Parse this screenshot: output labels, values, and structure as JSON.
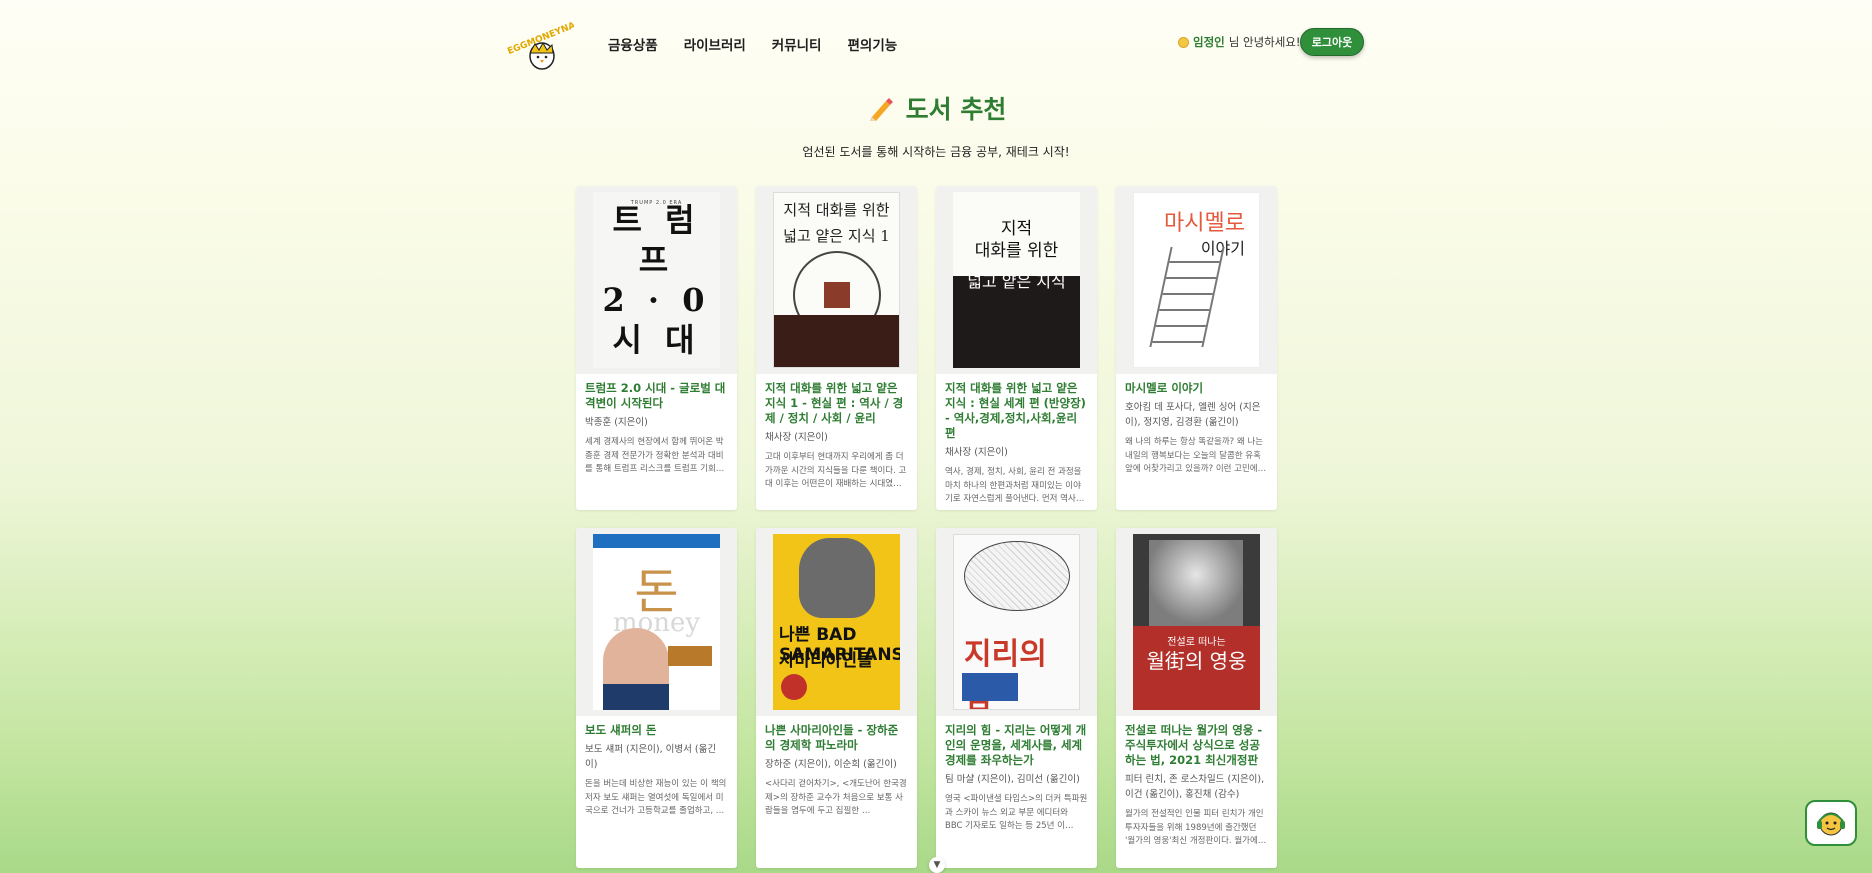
{
  "header": {
    "logo_text": "EGGMONEYNA",
    "nav": [
      "금융상품",
      "라이브러리",
      "커뮤니티",
      "편의기능"
    ],
    "user_name": "임정인",
    "greeting": "님 안녕하세요!",
    "logout_label": "로그아웃"
  },
  "page": {
    "title": "도서 추천",
    "subtitle": "엄선된 도서를 통해 시작하는 금융 공부, 재테크 시작!"
  },
  "books": [
    {
      "title": "트럼프 2.0 시대 - 글로벌 대격변이 시작된다",
      "author": "박종훈 (지은이)",
      "desc": "세계 경제사의 현장에서 함께 뛰어온 박종훈 경제 전문가가 정확한 분석과 대비를 통해 트럼프 리스크를 트럼프 기회…",
      "cover_text": [
        "트 럼 프",
        "2 · 0",
        "시 대"
      ],
      "cover_header": "TRUMP 2.0 ERA"
    },
    {
      "title": "지적 대화를 위한 넓고 얕은 지식 1 - 현실 편 : 역사 / 경제 / 정치 / 사회 / 윤리",
      "author": "채사장 (지은이)",
      "desc": "고대 이후부터 현대까지 우리에게 좀 더 가까운 시간의 지식들을 다룬 책이다. 고대 이후는 어떤은이 재배하는 시대였기…",
      "cover_text": [
        "지적 대화를 위한",
        "넓고 얕은 지식 1"
      ]
    },
    {
      "title": "지적 대화를 위한 넓고 얕은 지식 : 현실 세계 편 (반양장) - 역사,경제,정치,사회,윤리 편",
      "author": "채사장 (지은이)",
      "desc": "역사, 경제, 정치, 사회, 윤리 전 과정을 마치 하나의 한편과처럼 재미있는 이야기로 자연스럽게 풀어낸다. 먼저 역사는 …",
      "cover_text": [
        "지적",
        "대화를 위한",
        "넓고 얕은 지식"
      ]
    },
    {
      "title": "마시멜로 이야기",
      "author": "호아킴 데 포사다, 엘렌 싱어 (지은이), 정지영, 김경환 (옮긴이)",
      "desc": "왜 나의 하루는 항상 똑같을까? 왜 나는 내일의 행복보다는 오늘의 달콤한 유혹 앞에 어찾가리고 있을까? 이런 고민에 …",
      "cover_text": [
        "마시멜로",
        "이야기"
      ]
    },
    {
      "title": "보도 섀퍼의 돈",
      "author": "보도 섀퍼 (지은이), 이병서 (옮긴이)",
      "desc": "돈을 버는데 비상한 재능이 있는 이 책의 저자 보도 섀퍼는 열여섯에 독일에서 미국으로 건너가 고등학교를 졸업하고, …",
      "cover_text": [
        "돈",
        "money"
      ]
    },
    {
      "title": "나쁜 사마리아인들 - 장하준의 경제학 파노라마",
      "author": "장하준 (지은이), 이순희 (옮긴이)",
      "desc": "&lt;사다리 걷어차기&gt;, &lt;개도난어 한국경제&gt;의 장하준 교수가 처음으로 보통 사람들을 염두에 두고 집필한 …",
      "cover_text": [
        "나쁜 BAD SAMARITANS",
        "사마리아인들"
      ]
    },
    {
      "title": "지리의 힘 - 지리는 어떻게 개인의 운명을, 세계사를, 세계경제를 좌우하는가",
      "author": "팀 마샬 (지은이), 김미선 (옮긴이)",
      "desc": "영국 &lt;파이낸셜 타임스&gt;의 더커 특파원과 스카이 뉴스 외교 부문 에디터와 BBC 기자로도 일하는 등 25년 이…",
      "cover_text": [
        "지리의 힘"
      ]
    },
    {
      "title": "전설로 떠나는 월가의 영웅 - 주식투자에서 상식으로 성공하는 법, 2021 최신개정판",
      "author": "피터 린치, 존 로스차일드 (지은이), 이건 (옮긴이), 홍진채 (감수)",
      "desc": "월가의 전설적인 인물 피터 린치가 개인투자자들을 위해 1989년에 출간했던 '월가의 영웅'최신 개정판이다. 월가에서 …",
      "cover_text": [
        "전설로 떠나는",
        "월街의 영웅"
      ]
    }
  ],
  "colors": {
    "accent": "#2e7d32",
    "logout_bg": "#2f8f3b"
  },
  "icons": {
    "title_icon": "pencil-icon",
    "chatbot_icon": "chatbot-icon",
    "scroll_icon": "chevron-down-icon"
  }
}
